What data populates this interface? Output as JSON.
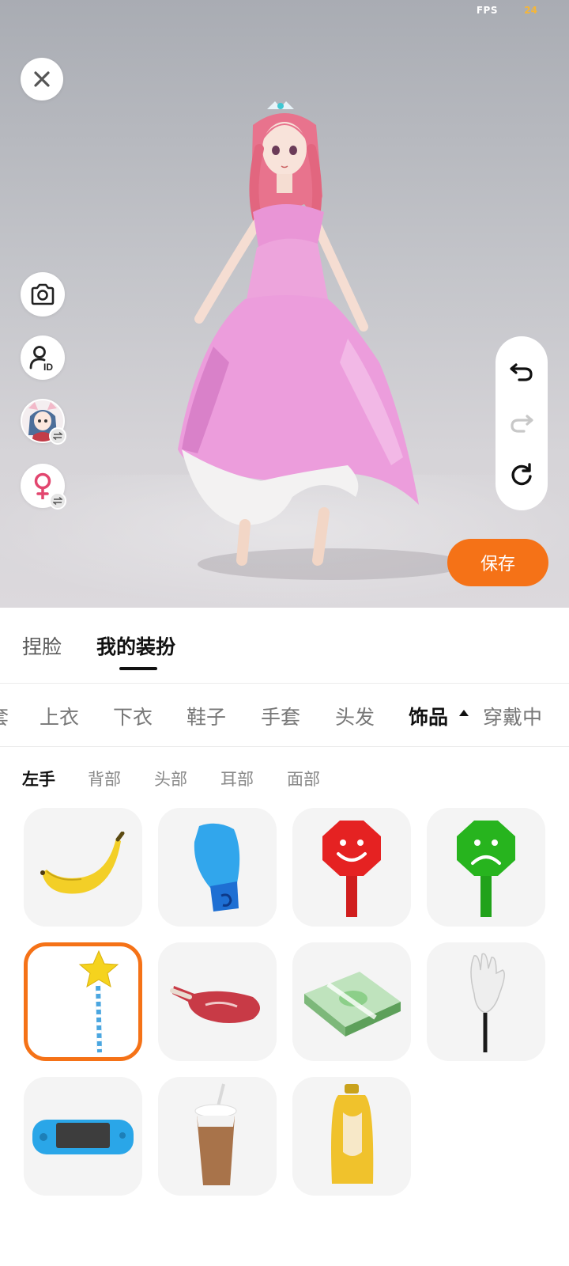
{
  "stage": {
    "fps_label": "FPS",
    "fps_value": "24",
    "close_icon": "close-icon",
    "left_tools": [
      {
        "name": "camera",
        "icon": "camera-icon"
      },
      {
        "name": "avatar-id",
        "icon": "user-id-icon"
      },
      {
        "name": "switch-avatar",
        "icon": "avatar-thumbnail"
      },
      {
        "name": "switch-gender",
        "icon": "female-icon"
      }
    ],
    "history": [
      "undo-icon",
      "redo-icon",
      "reset-icon"
    ],
    "save_label": "保存",
    "accent_color": "#f57217"
  },
  "main_tabs": [
    {
      "label": "捏脸",
      "active": false
    },
    {
      "label": "我的装扮",
      "active": true
    }
  ],
  "category_tabs": [
    {
      "label": "套",
      "active": false
    },
    {
      "label": "上衣",
      "active": false
    },
    {
      "label": "下衣",
      "active": false
    },
    {
      "label": "鞋子",
      "active": false
    },
    {
      "label": "手套",
      "active": false
    },
    {
      "label": "头发",
      "active": false
    },
    {
      "label": "饰品",
      "active": true
    },
    {
      "label": "穿戴中",
      "active": false
    }
  ],
  "sub_tabs": [
    {
      "label": "左手",
      "active": true
    },
    {
      "label": "背部",
      "active": false
    },
    {
      "label": "头部",
      "active": false
    },
    {
      "label": "耳部",
      "active": false
    },
    {
      "label": "面部",
      "active": false
    }
  ],
  "items": [
    {
      "name": "banana",
      "selected": false
    },
    {
      "name": "boxing-glove",
      "selected": false
    },
    {
      "name": "red-smiley-sign",
      "selected": false
    },
    {
      "name": "green-sad-sign",
      "selected": false
    },
    {
      "name": "star-wand",
      "selected": true
    },
    {
      "name": "steak",
      "selected": false
    },
    {
      "name": "money-stack",
      "selected": false
    },
    {
      "name": "white-glove-stick",
      "selected": false
    },
    {
      "name": "handheld-console",
      "selected": false
    },
    {
      "name": "coffee-cup",
      "selected": false
    },
    {
      "name": "yellow-bottle",
      "selected": false
    }
  ]
}
